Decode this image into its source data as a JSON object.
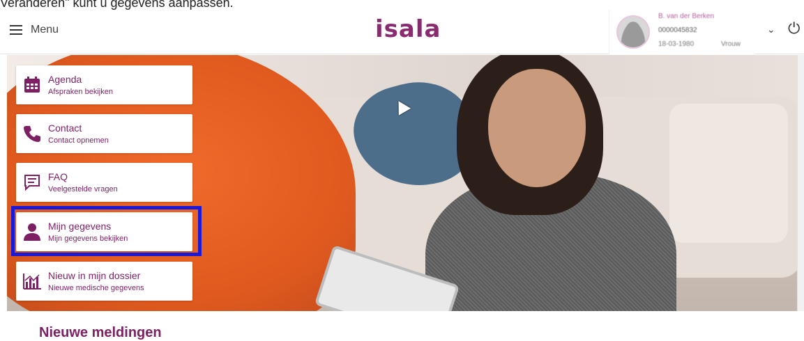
{
  "caption": "Veranderen\" kunt u gegevens aanpassen.",
  "header": {
    "menu_label": "Menu",
    "logo_text": "isala",
    "user": {
      "name": "B. van der Berken",
      "id": "0000045832",
      "dob": "18-03-1980",
      "gender": "Vrouw"
    }
  },
  "tiles": [
    {
      "title": "Agenda",
      "subtitle": "Afspraken bekijken",
      "icon": "calendar-icon"
    },
    {
      "title": "Contact",
      "subtitle": "Contact opnemen",
      "icon": "phone-icon"
    },
    {
      "title": "FAQ",
      "subtitle": "Veelgestelde vragen",
      "icon": "chat-icon"
    },
    {
      "title": "Mijn gegevens",
      "subtitle": "Mijn gegevens bekijken",
      "icon": "person-icon"
    },
    {
      "title": "Nieuw in mijn dossier",
      "subtitle": "Nieuwe medische gegevens",
      "icon": "chart-icon"
    }
  ],
  "section": {
    "title": "Nieuwe meldingen"
  },
  "colors": {
    "brand": "#7d1f63",
    "highlight": "#1a1ad6"
  }
}
